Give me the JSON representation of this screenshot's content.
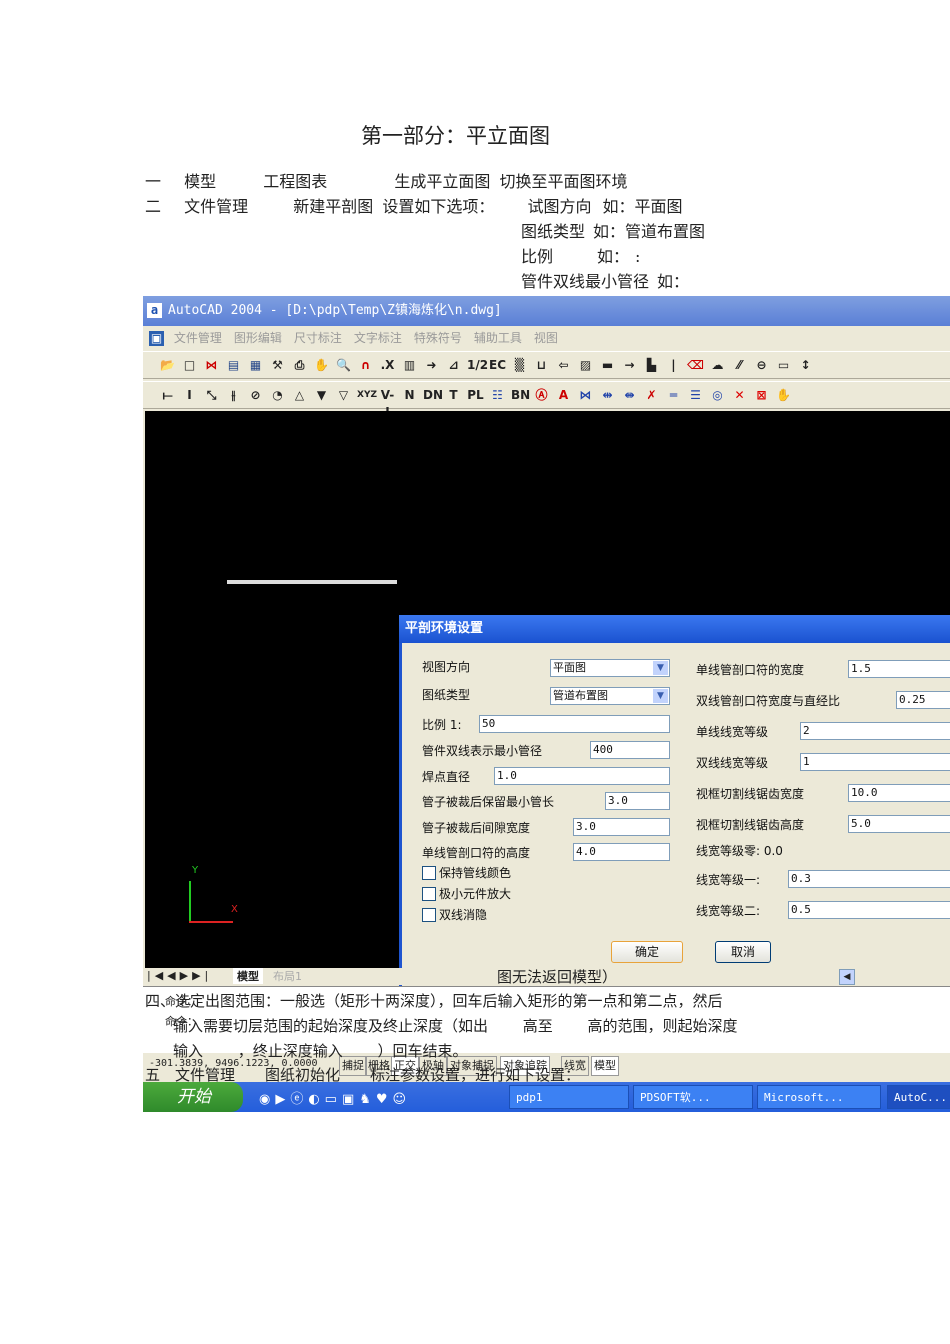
{
  "doc": {
    "title": "第一部分：平立面图",
    "line1": [
      "一",
      "模型",
      "工程图表",
      "生成平立面图",
      "切换至平面图环境"
    ],
    "line2": [
      "二",
      "文件管理",
      "新建平剖图",
      "设置如下选项：",
      "试图方向",
      "如：平面图"
    ],
    "line3": [
      "图纸类型",
      "如：管道布置图"
    ],
    "line4": [
      "比例",
      "如：",
      ":"
    ],
    "line5": [
      "管件双线最小管径",
      "如："
    ],
    "overlay_line0": "图无法返回模型）",
    "overlay_line1": "四、选定出图范围：一般选（矩形十两深度），回车后输入矩形的第一点和第二点，然后",
    "overlay_line2": "输入需要切层范围的起始深度及终止深度（如出 　　高至 　　高的范围，则起始深度",
    "overlay_line3": "输入 　　，终止深度输入 　　）回车结束。",
    "overlay_line4": "五　文件管理　　图纸初始化　　标注参数设置，进行如下设置："
  },
  "app": {
    "title": "AutoCAD 2004 - [D:\\pdp\\Temp\\Z镇海炼化\\n.dwg]",
    "menu": [
      "文件管理",
      "图形编辑",
      "尺寸标注",
      "文字标注",
      "特殊符号",
      "辅助工具",
      "视图"
    ],
    "toolbar2_text": [
      "V-I",
      "N",
      "DN",
      "T",
      "PL",
      "BN",
      "XYZ"
    ],
    "axis": {
      "y": "Y",
      "x": "X"
    },
    "tabs": [
      "模型",
      "布局1"
    ],
    "command_prompt": [
      "命令：",
      "命令："
    ],
    "coords": "-301.3839, 9496.1223, 0.0000",
    "status_buttons": [
      "捕捉",
      "栅格",
      "正交",
      "极轴",
      "对象捕捉",
      "对象追踪",
      "线宽",
      "模型"
    ],
    "taskbar": {
      "start": "开始",
      "items": [
        "pdp1",
        "PDSOFT软...",
        "Microsoft...",
        "AutoC..."
      ]
    }
  },
  "dialog": {
    "title": "平剖环境设置",
    "left": [
      {
        "label": "视图方向",
        "value": "平面图",
        "type": "select"
      },
      {
        "label": "图纸类型",
        "value": "管道布置图",
        "type": "select"
      },
      {
        "label": "比例 1:",
        "value": "50"
      },
      {
        "label": "管件双线表示最小管径",
        "value": "400"
      },
      {
        "label": "焊点直径",
        "value": "1.0"
      },
      {
        "label": "管子被裁后保留最小管长",
        "value": "3.0"
      },
      {
        "label": "管子被裁后间隙宽度",
        "value": "3.0"
      },
      {
        "label": "单线管剖口符的高度",
        "value": "4.0"
      }
    ],
    "checkboxes": [
      {
        "label": "保持管线颜色",
        "checked": false
      },
      {
        "label": "极小元件放大",
        "checked": false
      },
      {
        "label": "双线消隐",
        "checked": false
      }
    ],
    "right": [
      {
        "label": "单线管剖口符的宽度",
        "value": "1.5"
      },
      {
        "label": "双线管剖口符宽度与直经比",
        "value": "0.25"
      },
      {
        "label": "单线线宽等级",
        "value": "2"
      },
      {
        "label": "双线线宽等级",
        "value": "1"
      },
      {
        "label": "视框切割线锯齿宽度",
        "value": "10.0"
      },
      {
        "label": "视框切割线锯齿高度",
        "value": "5.0"
      },
      {
        "label": "线宽等级零: 0.0"
      },
      {
        "label": "线宽等级一:",
        "value": "0.3"
      },
      {
        "label": "线宽等级二:",
        "value": "0.5"
      }
    ],
    "ok": "确定",
    "cancel": "取消"
  }
}
